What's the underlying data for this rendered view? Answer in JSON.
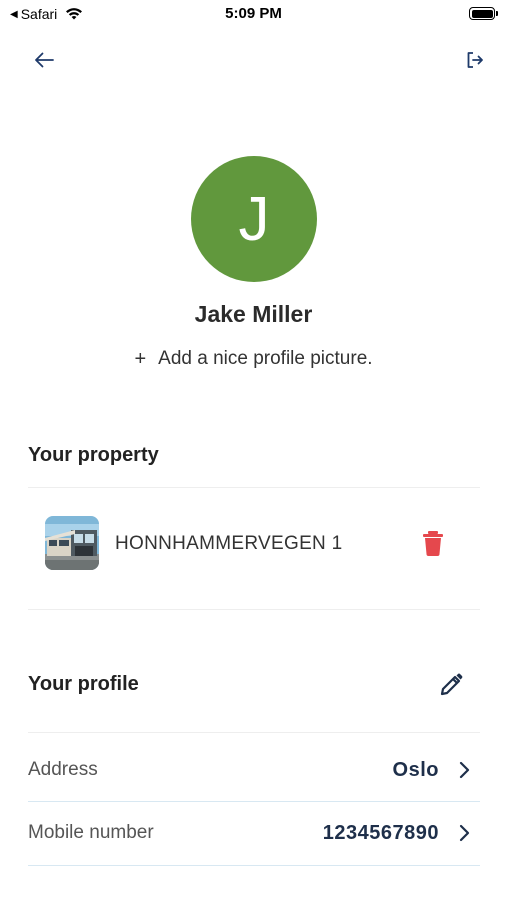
{
  "status_bar": {
    "back_app": "Safari",
    "time": "5:09 PM"
  },
  "header": {
    "back_icon": "arrow-left-icon",
    "logout_icon": "logout-icon"
  },
  "profile": {
    "avatar_initial": "J",
    "avatar_color": "#61983d",
    "name": "Jake Miller",
    "add_picture_plus": "+",
    "add_picture_label": "Add a nice profile picture."
  },
  "property_section": {
    "title": "Your property",
    "items": [
      {
        "name": "HONNHAMMERVEGEN 1",
        "delete_icon": "trash-icon",
        "delete_color": "#e5484d"
      }
    ]
  },
  "profile_section": {
    "title": "Your profile",
    "edit_icon": "pencil-icon",
    "rows": [
      {
        "label": "Address",
        "value": "Oslo"
      },
      {
        "label": "Mobile number",
        "value": "1234567890"
      }
    ]
  }
}
